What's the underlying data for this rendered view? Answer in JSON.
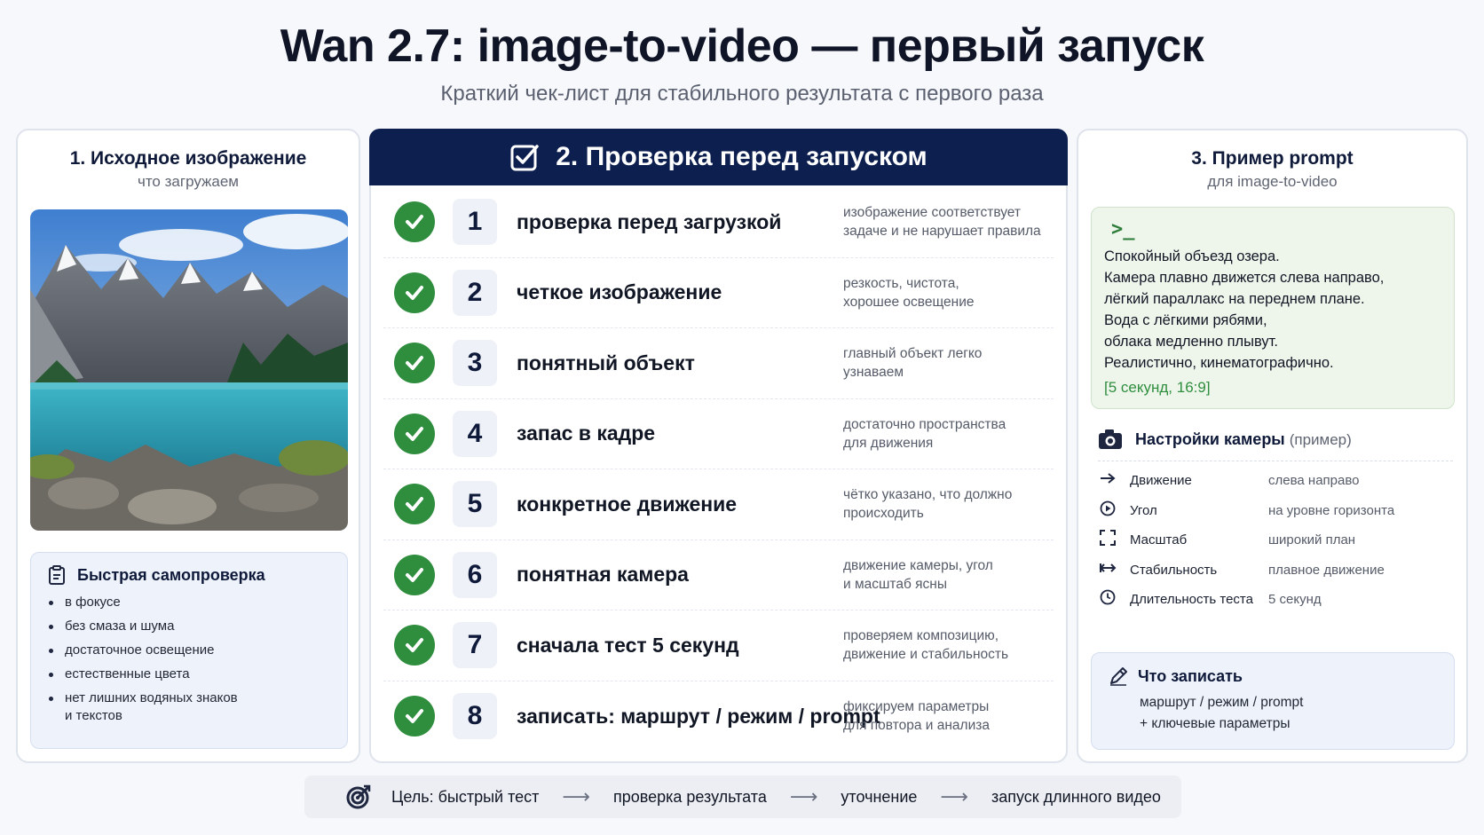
{
  "header": {
    "title": "Wan 2.7: image-to-video — первый запуск",
    "subtitle": "Краткий чек-лист для стабильного результата с первого раза"
  },
  "left": {
    "title": "1. Исходное изображение",
    "subtitle": "что загружаем",
    "quick_check": {
      "title": "Быстрая самопроверка",
      "items": [
        "в фокусе",
        "без смаза и шума",
        "достаточное освещение",
        "естественные цвета",
        "нет лишних водяных знаков",
        "и текстов"
      ]
    }
  },
  "middle": {
    "title": "2. Проверка перед запуском",
    "rows": [
      {
        "num": "1",
        "label": "проверка перед загрузкой",
        "desc1": "изображение соответствует",
        "desc2": "задаче и не нарушает правила"
      },
      {
        "num": "2",
        "label": "четкое изображение",
        "desc1": "резкость, чистота,",
        "desc2": "хорошее освещение"
      },
      {
        "num": "3",
        "label": "понятный объект",
        "desc1": "главный объект легко",
        "desc2": "узнаваем"
      },
      {
        "num": "4",
        "label": "запас в кадре",
        "desc1": "достаточно пространства",
        "desc2": "для движения"
      },
      {
        "num": "5",
        "label": "конкретное движение",
        "desc1": "чётко указано, что должно",
        "desc2": "происходить"
      },
      {
        "num": "6",
        "label": "понятная камера",
        "desc1": "движение камеры, угол",
        "desc2": "и масштаб ясны"
      },
      {
        "num": "7",
        "label": "сначала тест 5 секунд",
        "desc1": "проверяем композицию,",
        "desc2": "движение и стабильность"
      },
      {
        "num": "8",
        "label": "записать: маршрут / режим / prompt",
        "desc1": "фиксируем параметры",
        "desc2": "для повтора и анализа"
      }
    ]
  },
  "right": {
    "title": "3. Пример prompt",
    "subtitle": "для image-to-video",
    "prompt_symbol": ">_",
    "prompt_lines": [
      "Спокойный объезд озера.",
      "Камера плавно движется слева направо,",
      "лёгкий параллакс на переднем плане.",
      "Вода с лёгкими рябями,",
      "облака медленно плывут.",
      "Реалистично, кинематографично."
    ],
    "prompt_tag": "[5 секунд, 16:9]",
    "camera": {
      "title": "Настройки камеры",
      "title_note": "(пример)",
      "rows": [
        {
          "icon": "arrow-right-icon",
          "key": "Движение",
          "value": "слева направо"
        },
        {
          "icon": "play-circle-icon",
          "key": "Угол",
          "value": "на уровне горизонта"
        },
        {
          "icon": "frame-icon",
          "key": "Масштаб",
          "value": "широкий план"
        },
        {
          "icon": "horizontal-arrows-icon",
          "key": "Стабильность",
          "value": "плавное движение"
        },
        {
          "icon": "clock-icon",
          "key": "Длительность теста",
          "value": "5 секунд"
        }
      ]
    },
    "note": {
      "title": "Что записать",
      "line1": "маршрут / режим / prompt",
      "line2": "+ ключевые параметры"
    }
  },
  "footer": {
    "steps": [
      "Цель: быстрый тест",
      "проверка результата",
      "уточнение",
      "запуск длинного видео"
    ]
  },
  "colors": {
    "navy": "#0c1f4e",
    "green": "#2f8e3e",
    "soft_blue": "#eef3fb",
    "soft_green": "#eef6ec"
  }
}
